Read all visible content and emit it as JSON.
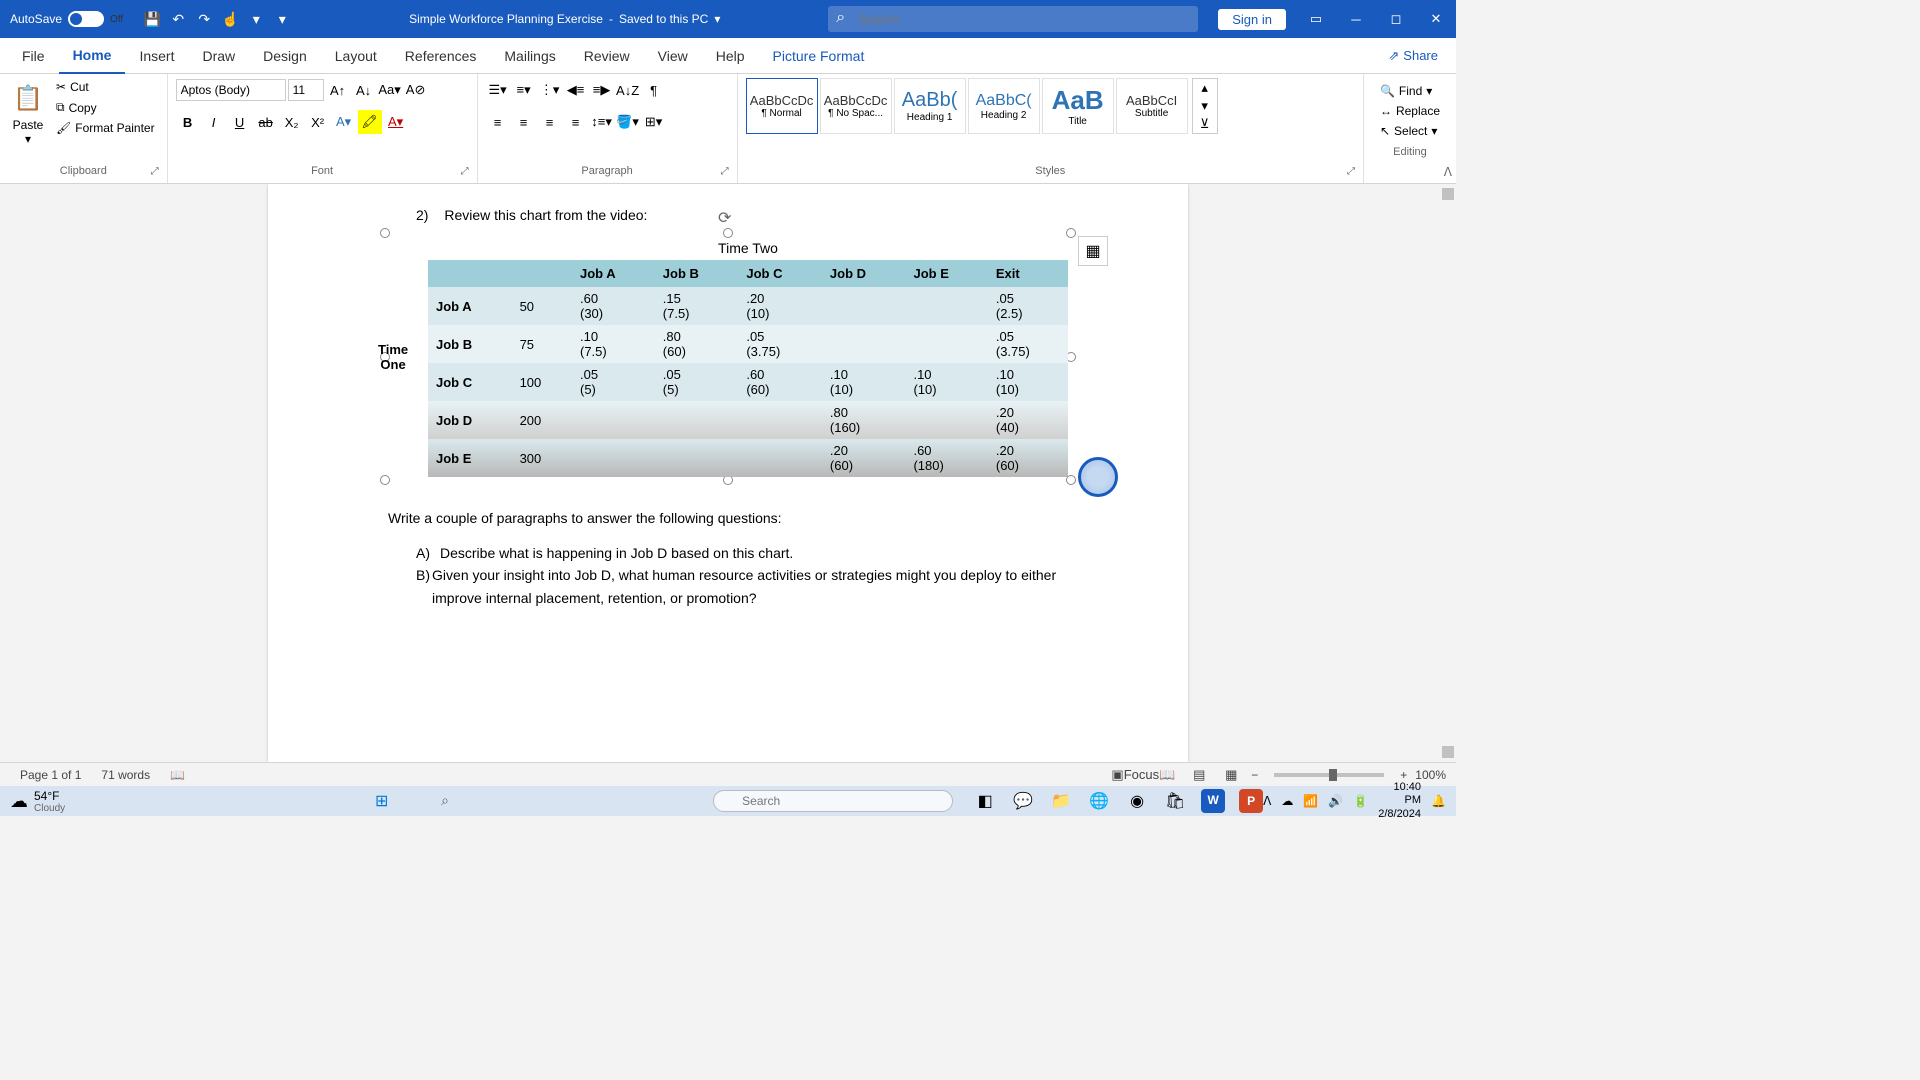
{
  "titlebar": {
    "autosave_label": "AutoSave",
    "autosave_state": "Off",
    "doc_title": "Simple Workforce Planning Exercise",
    "save_status": "Saved to this PC",
    "search_placeholder": "Search",
    "signin": "Sign in"
  },
  "tabs": {
    "file": "File",
    "home": "Home",
    "insert": "Insert",
    "draw": "Draw",
    "design": "Design",
    "layout": "Layout",
    "references": "References",
    "mailings": "Mailings",
    "review": "Review",
    "view": "View",
    "help": "Help",
    "picture_format": "Picture Format",
    "share": "Share"
  },
  "ribbon": {
    "paste": "Paste",
    "cut": "Cut",
    "copy": "Copy",
    "format_painter": "Format Painter",
    "clipboard_label": "Clipboard",
    "font_name": "Aptos (Body)",
    "font_size": "11",
    "font_label": "Font",
    "paragraph_label": "Paragraph",
    "styles": {
      "label": "Styles",
      "items": [
        {
          "preview": "AaBbCcDc",
          "name": "¶ Normal"
        },
        {
          "preview": "AaBbCcDc",
          "name": "¶ No Spac..."
        },
        {
          "preview": "AaBb(",
          "name": "Heading 1"
        },
        {
          "preview": "AaBbC(",
          "name": "Heading 2"
        },
        {
          "preview": "AaB",
          "name": "Title"
        },
        {
          "preview": "AaBbCcI",
          "name": "Subtitle"
        }
      ]
    },
    "find": "Find",
    "replace": "Replace",
    "select": "Select",
    "editing_label": "Editing"
  },
  "document": {
    "q2_num": "2)",
    "q2_text": "Review this chart from the video:",
    "chart": {
      "title_top": "Time Two",
      "title_left": "Time\nOne",
      "cols": [
        "Job A",
        "Job B",
        "Job C",
        "Job D",
        "Job E",
        "Exit"
      ],
      "rows": [
        {
          "label": "Job A",
          "n": "50",
          "cells": [
            ".60\n(30)",
            ".15\n(7.5)",
            ".20\n(10)",
            "",
            "",
            ".05\n(2.5)"
          ]
        },
        {
          "label": "Job B",
          "n": "75",
          "cells": [
            ".10\n(7.5)",
            ".80\n(60)",
            ".05\n(3.75)",
            "",
            "",
            ".05\n(3.75)"
          ]
        },
        {
          "label": "Job C",
          "n": "100",
          "cells": [
            ".05\n(5)",
            ".05\n(5)",
            ".60\n(60)",
            ".10\n(10)",
            ".10\n(10)",
            ".10\n(10)"
          ]
        },
        {
          "label": "Job D",
          "n": "200",
          "cells": [
            "",
            "",
            "",
            ".80\n(160)",
            "",
            ".20\n(40)"
          ]
        },
        {
          "label": "Job E",
          "n": "300",
          "cells": [
            "",
            "",
            "",
            ".20\n(60)",
            ".60\n(180)",
            ".20\n(60)"
          ]
        }
      ]
    },
    "instruction": "Write a couple of paragraphs to answer the following questions:",
    "qa_letter": "A)",
    "qa_text": "Describe what is happening in Job D based on this chart.",
    "qb_letter": "B)",
    "qb_text": "Given your insight into Job D, what human resource activities or strategies might you deploy to either improve internal placement, retention, or promotion?"
  },
  "statusbar": {
    "page": "Page 1 of 1",
    "words": "71 words",
    "focus": "Focus",
    "zoom": "100%"
  },
  "taskbar": {
    "temp": "54°F",
    "condition": "Cloudy",
    "search_placeholder": "Search",
    "time": "10:40 PM",
    "date": "2/8/2024"
  }
}
